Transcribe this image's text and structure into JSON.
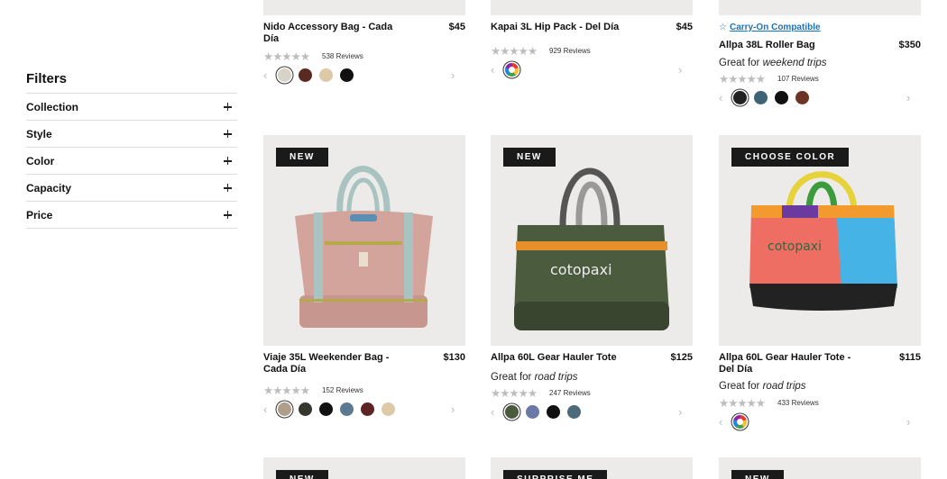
{
  "filters": {
    "title": "Filters",
    "items": [
      "Collection",
      "Style",
      "Color",
      "Capacity",
      "Price"
    ]
  },
  "top_products": [
    {
      "name": "Nido Accessory Bag - Cada Día",
      "price": "$45",
      "reviews": "538 Reviews",
      "swatches": [
        "#d8d3c8",
        "#5a2a22",
        "#ddc9a8",
        "#111111"
      ],
      "selected": 0
    },
    {
      "name": "Kapai 3L Hip Pack - Del Día",
      "price": "$45",
      "reviews": "929 Reviews",
      "swatches": [
        "multi"
      ],
      "selected": 0
    },
    {
      "carry_on": "Carry-On Compatible",
      "name": "Allpa 38L Roller Bag",
      "price": "$350",
      "tagline_prefix": "Great for",
      "tagline_em": "weekend trips",
      "reviews": "107 Reviews",
      "swatches": [
        "#222222",
        "#3e6276",
        "#111111",
        "#6b3424"
      ],
      "selected": 0
    }
  ],
  "products": [
    {
      "badge": "NEW",
      "name": "Viaje 35L Weekender Bag - Cada Día",
      "price": "$130",
      "reviews": "152 Reviews",
      "swatches": [
        "#b09e8c",
        "#34382c",
        "#111111",
        "#5b7a91",
        "#5e2424",
        "#ddc9a8"
      ],
      "selected": 0
    },
    {
      "badge": "NEW",
      "name": "Allpa 60L Gear Hauler Tote",
      "price": "$125",
      "tagline_prefix": "Great for",
      "tagline_em": "road trips",
      "reviews": "247 Reviews",
      "swatches": [
        "#4a5a3d",
        "#6b79a8",
        "#111111",
        "#4d6a7c"
      ],
      "selected": 0
    },
    {
      "badge": "CHOOSE COLOR",
      "name": "Allpa 60L Gear Hauler Tote - Del Día",
      "price": "$115",
      "tagline_prefix": "Great for",
      "tagline_em": "road trips",
      "reviews": "433 Reviews",
      "swatches": [
        "multi"
      ],
      "selected": 0
    }
  ],
  "bottom_badges": [
    "NEW",
    "SURPRISE ME",
    "NEW"
  ],
  "icons": {
    "star": "star-icon",
    "plus": "plus-icon",
    "chev_left": "chevron-left-icon",
    "chev_right": "chevron-right-icon"
  }
}
